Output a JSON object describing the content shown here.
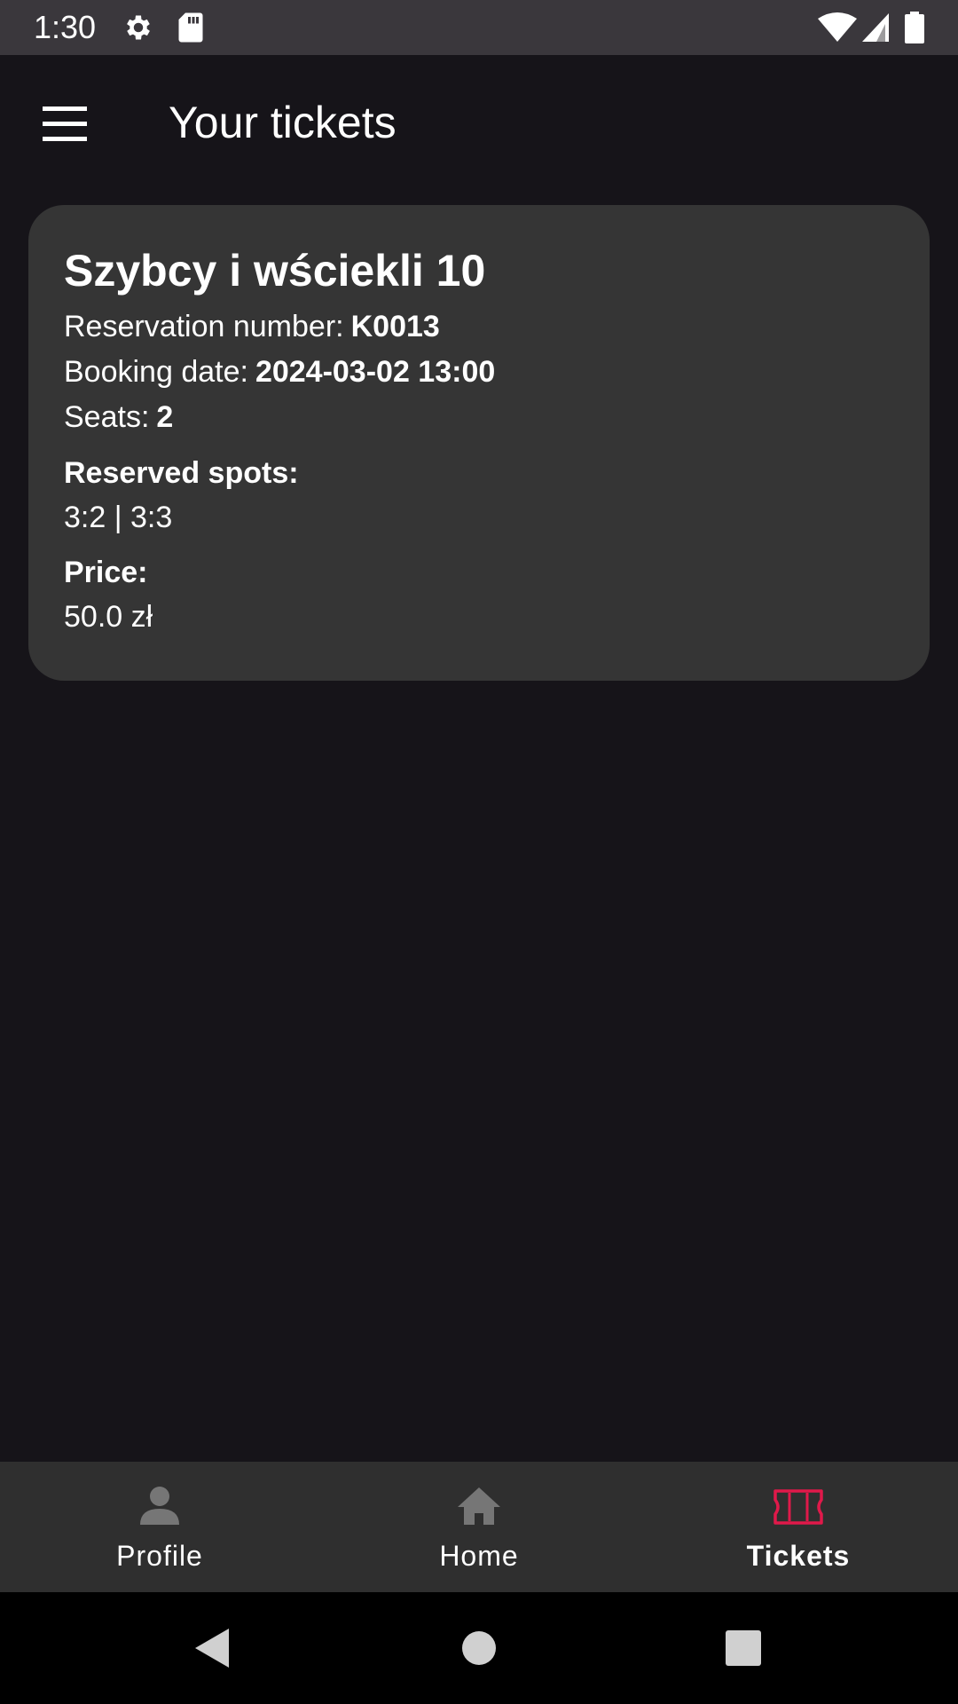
{
  "status_bar": {
    "time": "1:30",
    "icons": [
      "gear-icon",
      "sd-card-icon",
      "wifi-icon",
      "signal-icon",
      "battery-icon"
    ]
  },
  "app_bar": {
    "title": "Your tickets",
    "menu_icon": "hamburger-menu-icon"
  },
  "ticket": {
    "movie_title": "Szybcy i wściekli 10",
    "reservation_label": "Reservation number:",
    "reservation_value": "K0013",
    "booking_label": "Booking date:",
    "booking_value": "2024-03-02 13:00",
    "seats_label": "Seats:",
    "seats_value": "2",
    "spots_label": "Reserved spots:",
    "spots_value": "3:2 | 3:3",
    "price_label": "Price:",
    "price_value": "50.0 zł"
  },
  "bottom_nav": {
    "items": [
      {
        "label": "Profile",
        "icon": "person-icon",
        "active": false
      },
      {
        "label": "Home",
        "icon": "home-icon",
        "active": false
      },
      {
        "label": "Tickets",
        "icon": "ticket-icon",
        "active": true
      }
    ]
  },
  "system_nav": {
    "back_icon": "back-triangle-icon",
    "home_icon": "home-circle-icon",
    "recents_icon": "recents-square-icon"
  },
  "colors": {
    "background": "#161419",
    "card": "#353535",
    "bottom_nav": "#2f2f2f",
    "accent": "#e0194a",
    "inactive_icon": "#767676"
  }
}
